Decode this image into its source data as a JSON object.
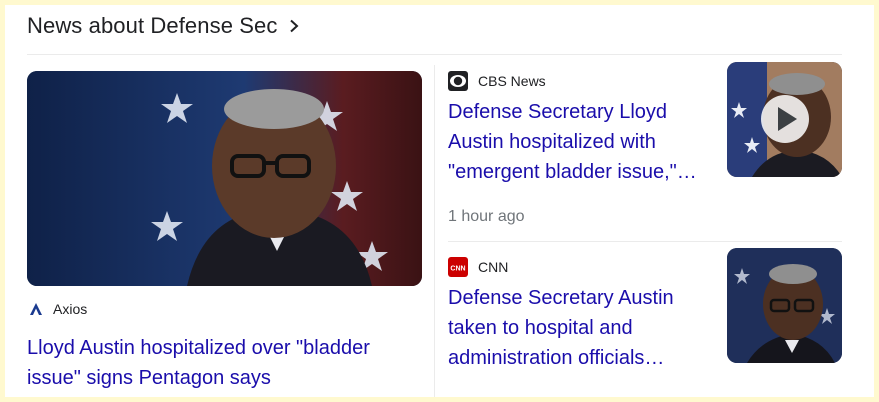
{
  "section": {
    "title": "News about Defense Sec"
  },
  "articles": [
    {
      "source": "Axios",
      "source_icon": "axios-logo",
      "headline": "Lloyd Austin hospitalized over \"bladder issue\" signs Pentagon says"
    },
    {
      "source": "CBS News",
      "source_icon": "cbs-eye-logo",
      "headline": "Defense Secretary Lloyd Austin hospitalized with \"emergent bladder issue,\"…",
      "time": "1 hour ago",
      "thumbnail_has_video": true
    },
    {
      "source": "CNN",
      "source_icon": "cnn-logo",
      "headline": "Defense Secretary Austin taken to hospital and administration officials…"
    }
  ],
  "colors": {
    "headline_link": "#1a0dab",
    "frame_outline": "#fff9cf",
    "cnn_red": "#cc0000"
  }
}
